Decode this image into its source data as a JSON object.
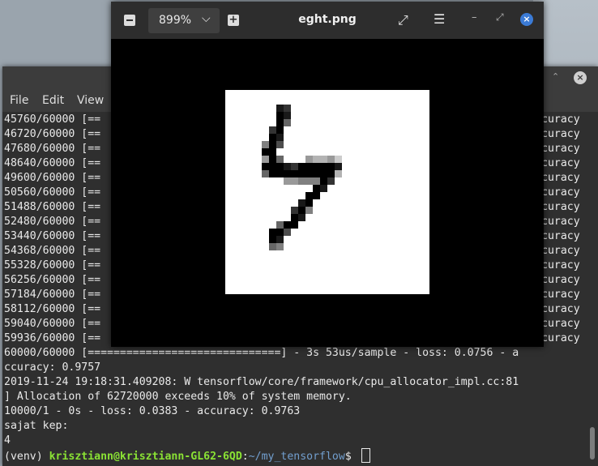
{
  "terminal": {
    "menu": [
      "File",
      "Edit",
      "View"
    ],
    "lines": [
      {
        "left": "45760/60000 [==",
        "right": "curacy"
      },
      {
        "left": "46720/60000 [==",
        "right": "curacy"
      },
      {
        "left": "47680/60000 [==",
        "right": "curacy"
      },
      {
        "left": "48640/60000 [==",
        "right": "curacy"
      },
      {
        "left": "49600/60000 [==",
        "right": "curacy"
      },
      {
        "left": "50560/60000 [==",
        "right": "curacy"
      },
      {
        "left": "51488/60000 [==",
        "right": "curacy"
      },
      {
        "left": "52480/60000 [==",
        "right": "curacy"
      },
      {
        "left": "53440/60000 [==",
        "right": "curacy"
      },
      {
        "left": "54368/60000 [==",
        "right": "curacy"
      },
      {
        "left": "55328/60000 [==",
        "right": "curacy"
      },
      {
        "left": "56256/60000 [==",
        "right": "curacy"
      },
      {
        "left": "57184/60000 [==",
        "right": "curacy"
      },
      {
        "left": "58112/60000 [==",
        "right": "curacy"
      },
      {
        "left": "59040/60000 [==",
        "right": "curacy"
      },
      {
        "left": "59936/60000 [==",
        "right": "curacy"
      },
      {
        "left": "60000/60000 [==============================] - 3s 53us/sample - loss: 0.0756 - a",
        "right": ""
      },
      {
        "left": "ccuracy: 0.9757",
        "right": ""
      },
      {
        "left": "2019-11-24 19:18:31.409208: W tensorflow/core/framework/cpu_allocator_impl.cc:81",
        "right": ""
      },
      {
        "left": "] Allocation of 62720000 exceeds 10% of system memory.",
        "right": ""
      },
      {
        "left": "10000/1 - 0s - loss: 0.0383 - accuracy: 0.9763",
        "right": ""
      },
      {
        "left": "sajat kep:",
        "right": ""
      },
      {
        "left": "4",
        "right": ""
      }
    ],
    "prompt": {
      "venv": "(venv) ",
      "user": "krisztiann@krisztiann-GL62-6QD",
      "sep": ":",
      "path": "~/my_tensorflow",
      "symbol": "$ "
    }
  },
  "viewer": {
    "zoom": "899%",
    "title": "eght.png",
    "digit_pixels": [
      [
        3,
        0,
        0.9
      ],
      [
        4,
        0,
        0.8
      ],
      [
        3,
        1,
        1
      ],
      [
        4,
        1,
        0.9
      ],
      [
        3,
        2,
        1
      ],
      [
        4,
        2,
        0.6
      ],
      [
        2,
        3,
        0.8
      ],
      [
        3,
        3,
        1
      ],
      [
        2,
        4,
        1
      ],
      [
        3,
        4,
        0.9
      ],
      [
        1,
        5,
        0.5
      ],
      [
        2,
        5,
        1
      ],
      [
        3,
        5,
        0.7
      ],
      [
        1,
        6,
        1
      ],
      [
        2,
        6,
        1
      ],
      [
        1,
        7,
        0.4
      ],
      [
        2,
        7,
        1
      ],
      [
        3,
        7,
        0.6
      ],
      [
        7,
        7,
        0.4
      ],
      [
        8,
        7,
        0.3
      ],
      [
        9,
        7,
        0.3
      ],
      [
        10,
        7,
        0.4
      ],
      [
        11,
        7,
        0.2
      ],
      [
        1,
        8,
        1
      ],
      [
        2,
        8,
        1
      ],
      [
        3,
        8,
        1
      ],
      [
        4,
        8,
        0.9
      ],
      [
        5,
        8,
        0.8
      ],
      [
        6,
        8,
        1
      ],
      [
        7,
        8,
        1
      ],
      [
        8,
        8,
        1
      ],
      [
        9,
        8,
        1
      ],
      [
        10,
        8,
        1
      ],
      [
        11,
        8,
        0.9
      ],
      [
        1,
        9,
        0.6
      ],
      [
        2,
        9,
        1
      ],
      [
        3,
        9,
        1
      ],
      [
        4,
        9,
        1
      ],
      [
        5,
        9,
        1
      ],
      [
        6,
        9,
        1
      ],
      [
        7,
        9,
        1
      ],
      [
        8,
        9,
        1
      ],
      [
        9,
        9,
        1
      ],
      [
        10,
        9,
        1
      ],
      [
        11,
        9,
        0.3
      ],
      [
        4,
        10,
        0.4
      ],
      [
        5,
        10,
        0.4
      ],
      [
        6,
        10,
        0.5
      ],
      [
        7,
        10,
        0.5
      ],
      [
        8,
        10,
        0.5
      ],
      [
        9,
        10,
        1
      ],
      [
        10,
        10,
        0.8
      ],
      [
        8,
        11,
        1
      ],
      [
        9,
        11,
        0.9
      ],
      [
        7,
        12,
        1
      ],
      [
        8,
        12,
        1
      ],
      [
        6,
        13,
        0.9
      ],
      [
        7,
        13,
        1
      ],
      [
        5,
        14,
        0.8
      ],
      [
        6,
        14,
        1
      ],
      [
        7,
        14,
        0.5
      ],
      [
        5,
        15,
        1
      ],
      [
        6,
        15,
        0.9
      ],
      [
        3,
        16,
        0.6
      ],
      [
        4,
        16,
        1
      ],
      [
        5,
        16,
        1
      ],
      [
        2,
        17,
        1
      ],
      [
        3,
        17,
        1
      ],
      [
        4,
        17,
        0.7
      ],
      [
        2,
        18,
        1
      ],
      [
        3,
        18,
        0.9
      ],
      [
        2,
        19,
        0.6
      ],
      [
        3,
        19,
        0.5
      ]
    ]
  }
}
